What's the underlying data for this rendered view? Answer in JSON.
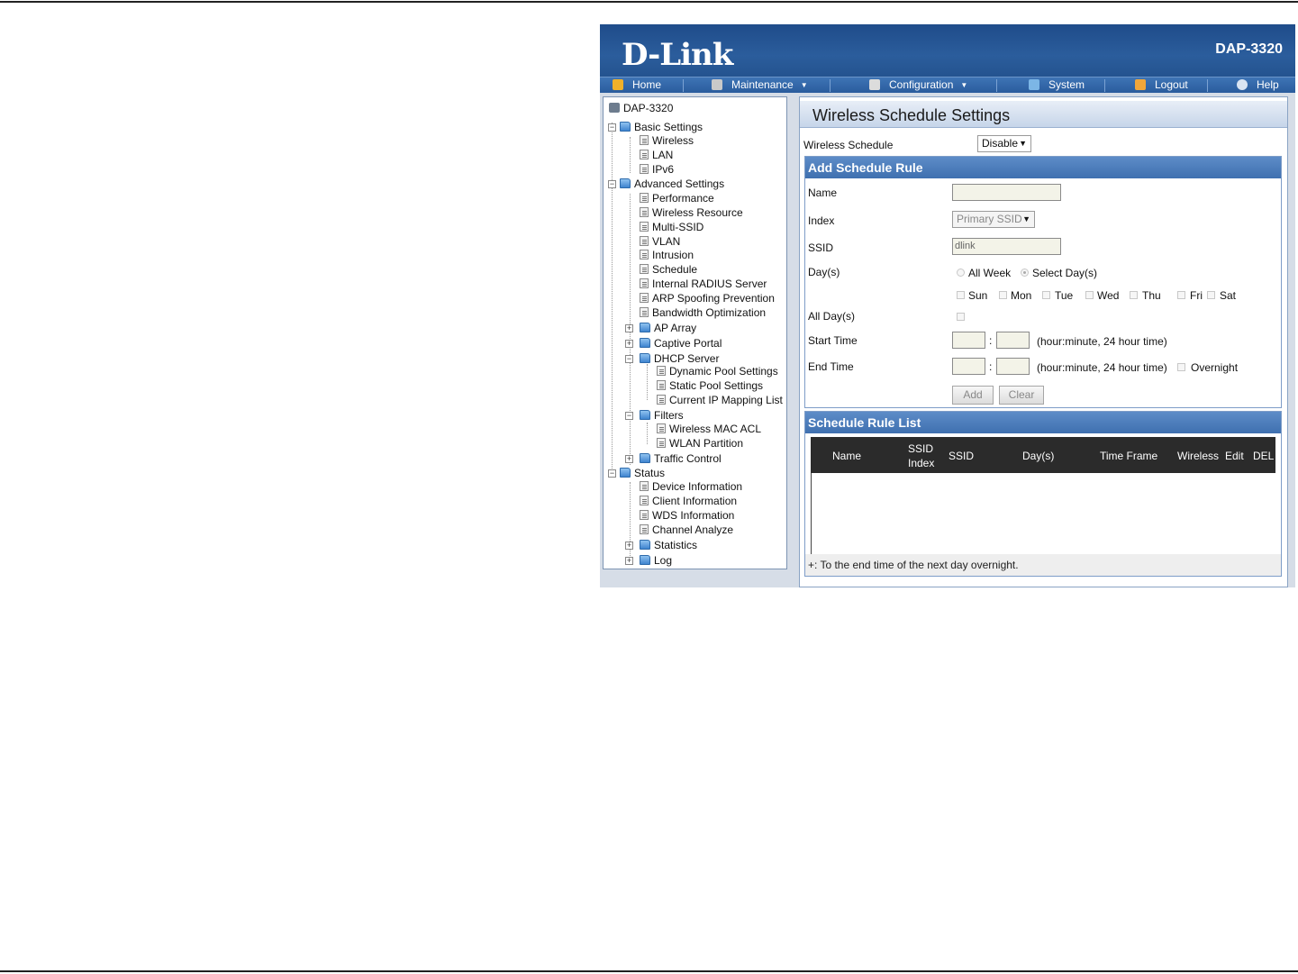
{
  "header": {
    "logo": "D-Link",
    "model": "DAP-3320"
  },
  "nav": {
    "home": "Home",
    "maintenance": "Maintenance",
    "configuration": "Configuration",
    "system": "System",
    "logout": "Logout",
    "help": "Help"
  },
  "tree": {
    "root": "DAP-3320",
    "basic": "Basic Settings",
    "wireless": "Wireless",
    "lan": "LAN",
    "ipv6": "IPv6",
    "advanced": "Advanced Settings",
    "performance": "Performance",
    "wireless_resource": "Wireless Resource",
    "multi_ssid": "Multi-SSID",
    "vlan": "VLAN",
    "intrusion": "Intrusion",
    "schedule": "Schedule",
    "radius": "Internal RADIUS Server",
    "arp": "ARP Spoofing Prevention",
    "bandwidth": "Bandwidth Optimization",
    "ap_array": "AP Array",
    "captive": "Captive Portal",
    "dhcp": "DHCP Server",
    "dynamic_pool": "Dynamic Pool Settings",
    "static_pool": "Static Pool Settings",
    "ip_mapping": "Current IP Mapping List",
    "filters": "Filters",
    "mac_acl": "Wireless MAC ACL",
    "wlan_partition": "WLAN Partition",
    "traffic": "Traffic Control",
    "status": "Status",
    "device_info": "Device Information",
    "client_info": "Client Information",
    "wds_info": "WDS Information",
    "channel": "Channel Analyze",
    "statistics": "Statistics",
    "log": "Log"
  },
  "main": {
    "title": "Wireless Schedule Settings",
    "schedule_label": "Wireless Schedule",
    "schedule_value": "Disable",
    "add_rule": {
      "heading": "Add Schedule Rule",
      "name_label": "Name",
      "name_value": "",
      "index_label": "Index",
      "index_value": "Primary SSID",
      "ssid_label": "SSID",
      "ssid_value": "dlink",
      "days_label": "Day(s)",
      "all_week": "All Week",
      "select_days": "Select Day(s)",
      "sun": "Sun",
      "mon": "Mon",
      "tue": "Tue",
      "wed": "Wed",
      "thu": "Thu",
      "fri": "Fri",
      "sat": "Sat",
      "all_day_label": "All Day(s)",
      "start_label": "Start Time",
      "end_label": "End Time",
      "colon": ":",
      "time_hint": "(hour:minute, 24 hour time)",
      "overnight": "Overnight",
      "add_button": "Add",
      "clear_button": "Clear"
    },
    "rule_list": {
      "heading": "Schedule Rule List",
      "columns": {
        "name": "Name",
        "ssid_index_1": "SSID",
        "ssid_index_2": "Index",
        "ssid": "SSID",
        "days": "Day(s)",
        "time_frame": "Time Frame",
        "wireless": "Wireless",
        "edit": "Edit",
        "del": "DEL"
      },
      "footnote": "+: To the end time of the next day overnight."
    }
  }
}
